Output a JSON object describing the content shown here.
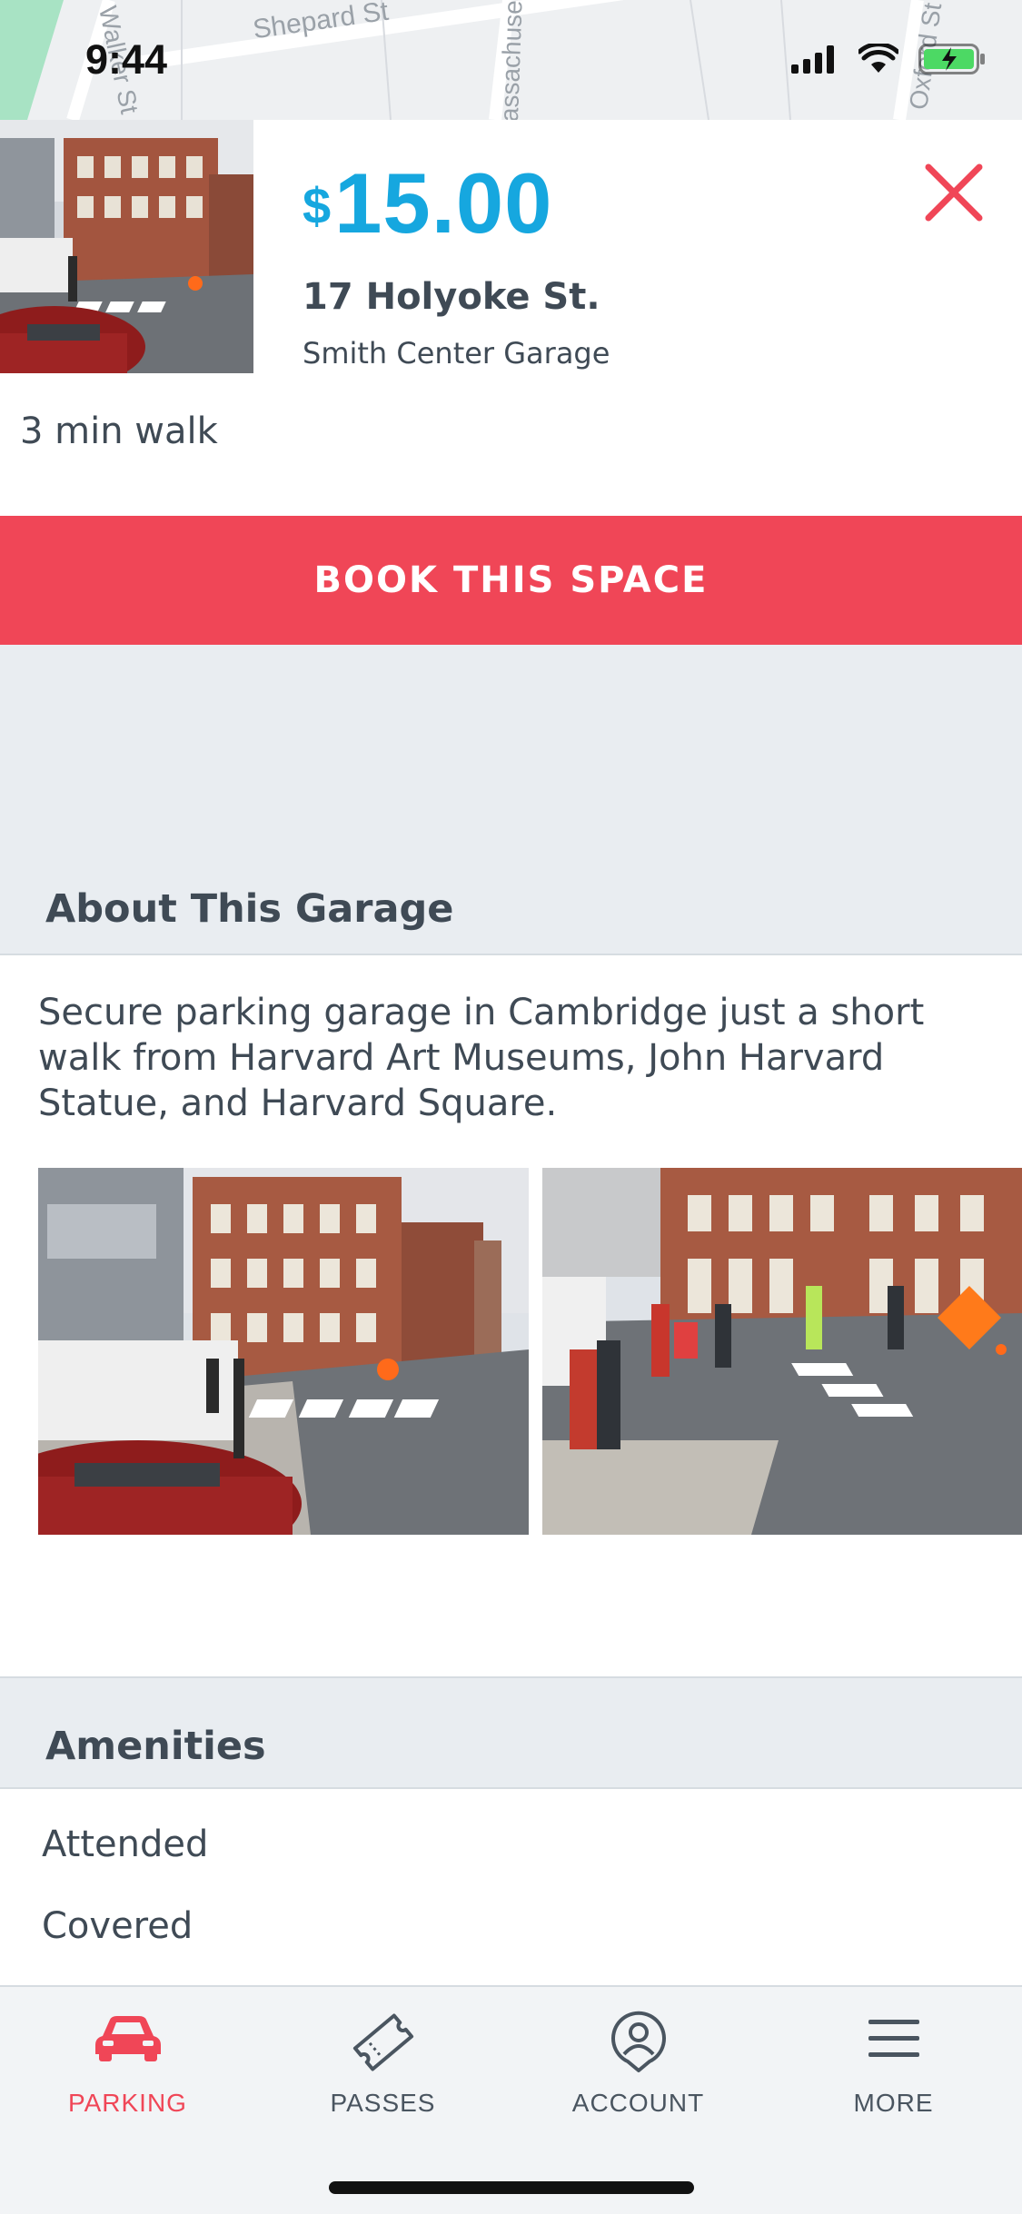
{
  "status": {
    "time": "9:44"
  },
  "map": {
    "labels": [
      "Shepard St",
      "Massachusetts",
      "Oxford St",
      "Walker St"
    ]
  },
  "listing": {
    "currency": "$",
    "price": "15.00",
    "address": "17 Holyoke St.",
    "garage_name": "Smith Center Garage",
    "walk_time": "3 min walk",
    "book_label": "BOOK THIS SPACE"
  },
  "about": {
    "title": "About This Garage",
    "description": "Secure parking garage in Cambridge just a short walk from Harvard Art Museums, John Harvard Statue, and Harvard Square."
  },
  "amenities": {
    "title": "Amenities",
    "items": [
      "Attended",
      "Covered"
    ]
  },
  "tabs": [
    {
      "label": "PARKING",
      "icon": "car-icon",
      "active": true
    },
    {
      "label": "PASSES",
      "icon": "ticket-icon",
      "active": false
    },
    {
      "label": "ACCOUNT",
      "icon": "account-icon",
      "active": false
    },
    {
      "label": "MORE",
      "icon": "menu-icon",
      "active": false
    }
  ],
  "colors": {
    "accent_red": "#f04657",
    "price_blue": "#16a7df",
    "text_dark": "#3f4a55",
    "background": "#e9edf1"
  }
}
